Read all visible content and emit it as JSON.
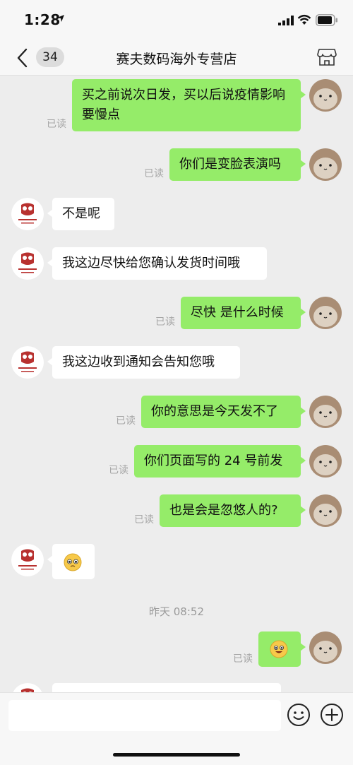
{
  "status_bar": {
    "time": "1:28"
  },
  "nav": {
    "unread_count": "34",
    "title": "赛夫数码海外专营店"
  },
  "messages": [
    {
      "text": "买之前说次日发，买以后说疫情影响要慢点",
      "read": "已读"
    },
    {
      "text": "你们是变脸表演吗",
      "read": "已读"
    },
    {
      "text": "不是呢"
    },
    {
      "text": "我这边尽快给您确认发货时间哦"
    },
    {
      "text": "尽快 是什么时候",
      "read": "已读"
    },
    {
      "text": "我这边收到通知会告知您哦"
    },
    {
      "text": "你的意思是今天发不了",
      "read": "已读"
    },
    {
      "text": "你们页面写的 24 号前发",
      "read": "已读"
    },
    {
      "text": "也是会是忽悠人的?",
      "read": "已读"
    },
    {
      "emoji": "pleading-face"
    },
    {
      "emoji": "grinning-face",
      "read": "已读"
    }
  ],
  "timestamp": "昨天 08:52",
  "input": {
    "placeholder": ""
  },
  "colors": {
    "my_bubble": "#95ec69",
    "shop_bubble": "#ffffff",
    "background": "#ededed",
    "shop_logo": "#b8312f"
  }
}
